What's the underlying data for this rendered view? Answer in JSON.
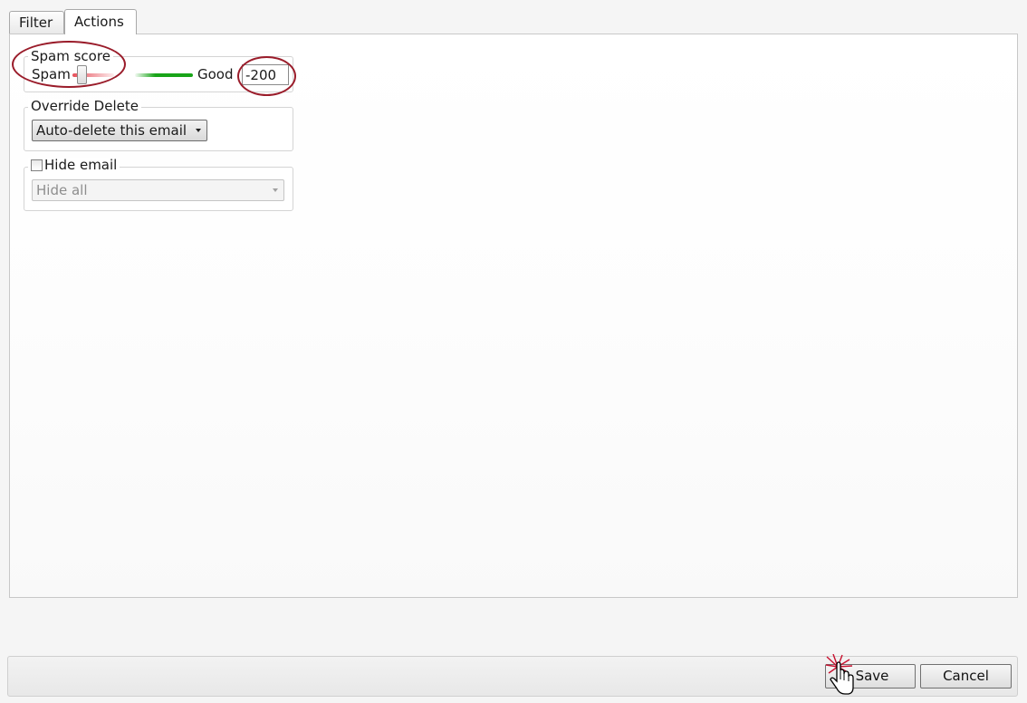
{
  "tabs": [
    {
      "label": "Filter"
    },
    {
      "label": "Actions"
    }
  ],
  "spam_score": {
    "legend": "Spam score",
    "low_label": "Spam",
    "high_label": "Good",
    "value": "-200",
    "slider_fraction": 0.0,
    "low_color": "#e7505a",
    "high_color": "#18a418"
  },
  "override_delete": {
    "legend": "Override Delete",
    "selected": "Auto-delete this email"
  },
  "hide_email": {
    "checkbox_label": "Hide email",
    "checked": false,
    "selected": "Hide all"
  },
  "footer": {
    "save_label": "Save",
    "cancel_label": "Cancel"
  },
  "annotation_color": "#9a1c2a"
}
